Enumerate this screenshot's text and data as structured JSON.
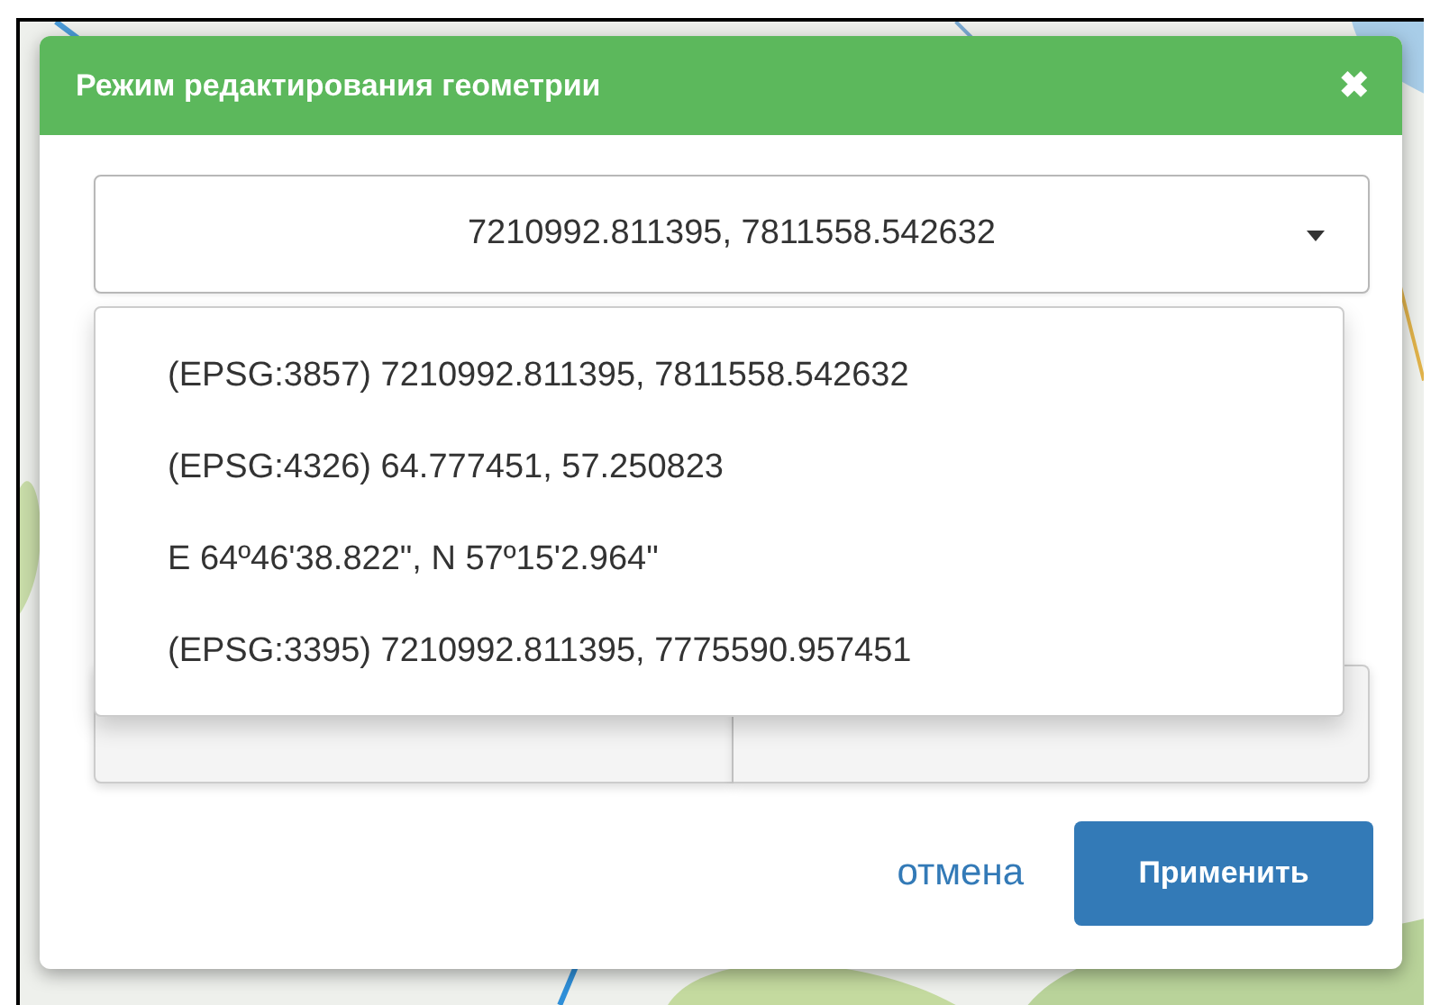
{
  "dialog": {
    "title": "Режим редактирования геометрии",
    "close": "✖"
  },
  "coordinate_select": {
    "value": "7210992.811395, 7811558.542632",
    "expanded": true,
    "options": [
      {
        "label": "(EPSG:3857) 7210992.811395, 7811558.542632",
        "selected": false
      },
      {
        "label": "(EPSG:4326) 64.777451, 57.250823",
        "selected": false
      },
      {
        "label": "E 64º46'38.822\", N 57º15'2.964\"",
        "selected": false
      },
      {
        "label": "(EPSG:3395) 7210992.811395, 7775590.957451",
        "selected": false
      }
    ]
  },
  "footer": {
    "cancel": "отмена",
    "apply": "Применить"
  }
}
